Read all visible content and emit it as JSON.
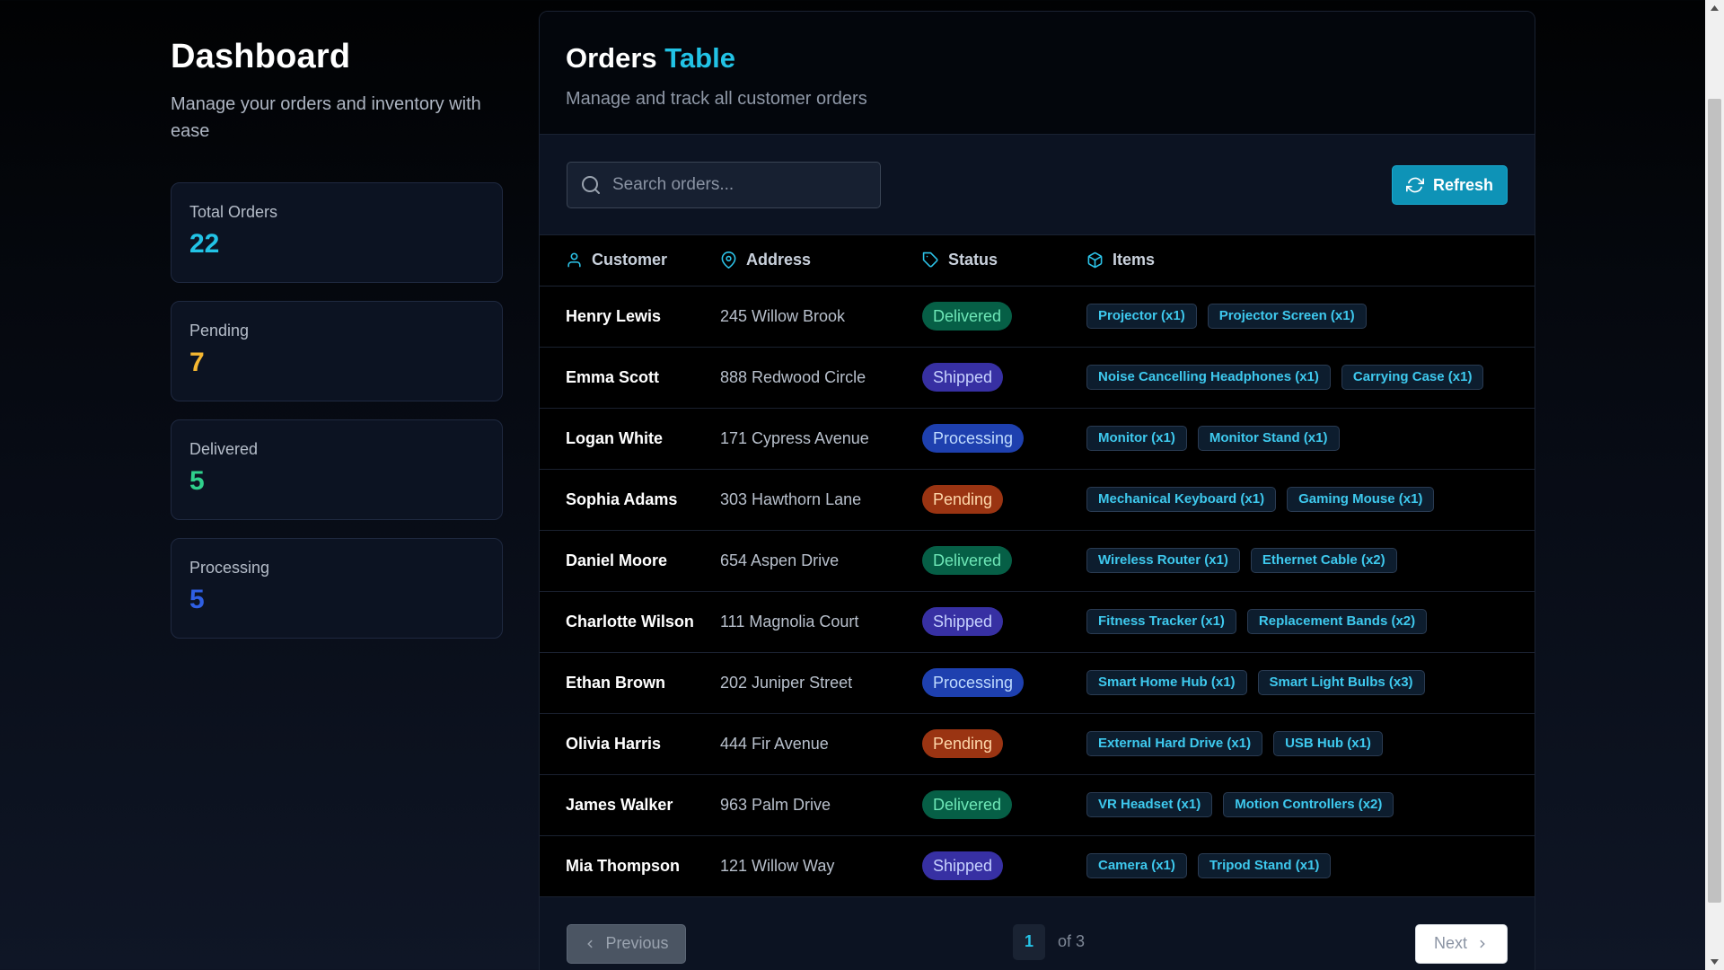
{
  "sidebar": {
    "title": "Dashboard",
    "subtitle": "Manage your orders and inventory with ease",
    "stats": [
      {
        "label": "Total Orders",
        "value": "22",
        "color": "#22c3e6"
      },
      {
        "label": "Pending",
        "value": "7",
        "color": "#f5b731"
      },
      {
        "label": "Delivered",
        "value": "5",
        "color": "#2fd08c"
      },
      {
        "label": "Processing",
        "value": "5",
        "color": "#2f5fe3"
      }
    ]
  },
  "main": {
    "title_main": "Orders",
    "title_accent": "Table",
    "subtitle": "Manage and track all customer orders",
    "search": {
      "placeholder": "Search orders...",
      "value": "",
      "icon": "search-icon"
    },
    "refresh_label": "Refresh",
    "columns": [
      {
        "label": "Customer",
        "icon": "user-icon"
      },
      {
        "label": "Address",
        "icon": "map-pin-icon"
      },
      {
        "label": "Status",
        "icon": "tag-icon"
      },
      {
        "label": "Items",
        "icon": "package-icon"
      }
    ],
    "status_colors": {
      "Delivered": {
        "bg": "#065f46",
        "fg": "#6ee7b7"
      },
      "Shipped": {
        "bg": "#3730a3",
        "fg": "#c7d2fe"
      },
      "Processing": {
        "bg": "#1e40af",
        "fg": "#bfdbfe"
      },
      "Pending": {
        "bg": "#9a3412",
        "fg": "#fed7aa"
      }
    },
    "rows": [
      {
        "customer": "Henry Lewis",
        "address": "245 Willow Brook",
        "status": "Delivered",
        "items": [
          "Projector (x1)",
          "Projector Screen (x1)"
        ]
      },
      {
        "customer": "Emma Scott",
        "address": "888 Redwood Circle",
        "status": "Shipped",
        "items": [
          "Noise Cancelling Headphones (x1)",
          "Carrying Case (x1)"
        ]
      },
      {
        "customer": "Logan White",
        "address": "171 Cypress Avenue",
        "status": "Processing",
        "items": [
          "Monitor (x1)",
          "Monitor Stand (x1)"
        ]
      },
      {
        "customer": "Sophia Adams",
        "address": "303 Hawthorn Lane",
        "status": "Pending",
        "items": [
          "Mechanical Keyboard (x1)",
          "Gaming Mouse (x1)"
        ]
      },
      {
        "customer": "Daniel Moore",
        "address": "654 Aspen Drive",
        "status": "Delivered",
        "items": [
          "Wireless Router (x1)",
          "Ethernet Cable (x2)"
        ]
      },
      {
        "customer": "Charlotte Wilson",
        "address": "111 Magnolia Court",
        "status": "Shipped",
        "items": [
          "Fitness Tracker (x1)",
          "Replacement Bands (x2)"
        ]
      },
      {
        "customer": "Ethan Brown",
        "address": "202 Juniper Street",
        "status": "Processing",
        "items": [
          "Smart Home Hub (x1)",
          "Smart Light Bulbs (x3)"
        ]
      },
      {
        "customer": "Olivia Harris",
        "address": "444 Fir Avenue",
        "status": "Pending",
        "items": [
          "External Hard Drive (x1)",
          "USB Hub (x1)"
        ]
      },
      {
        "customer": "James Walker",
        "address": "963 Palm Drive",
        "status": "Delivered",
        "items": [
          "VR Headset (x1)",
          "Motion Controllers (x2)"
        ]
      },
      {
        "customer": "Mia Thompson",
        "address": "121 Willow Way",
        "status": "Shipped",
        "items": [
          "Camera (x1)",
          "Tripod Stand (x1)"
        ]
      }
    ],
    "pagination": {
      "previous_label": "Previous",
      "current_page": "1",
      "of_text": "of 3",
      "next_label": "Next"
    }
  }
}
